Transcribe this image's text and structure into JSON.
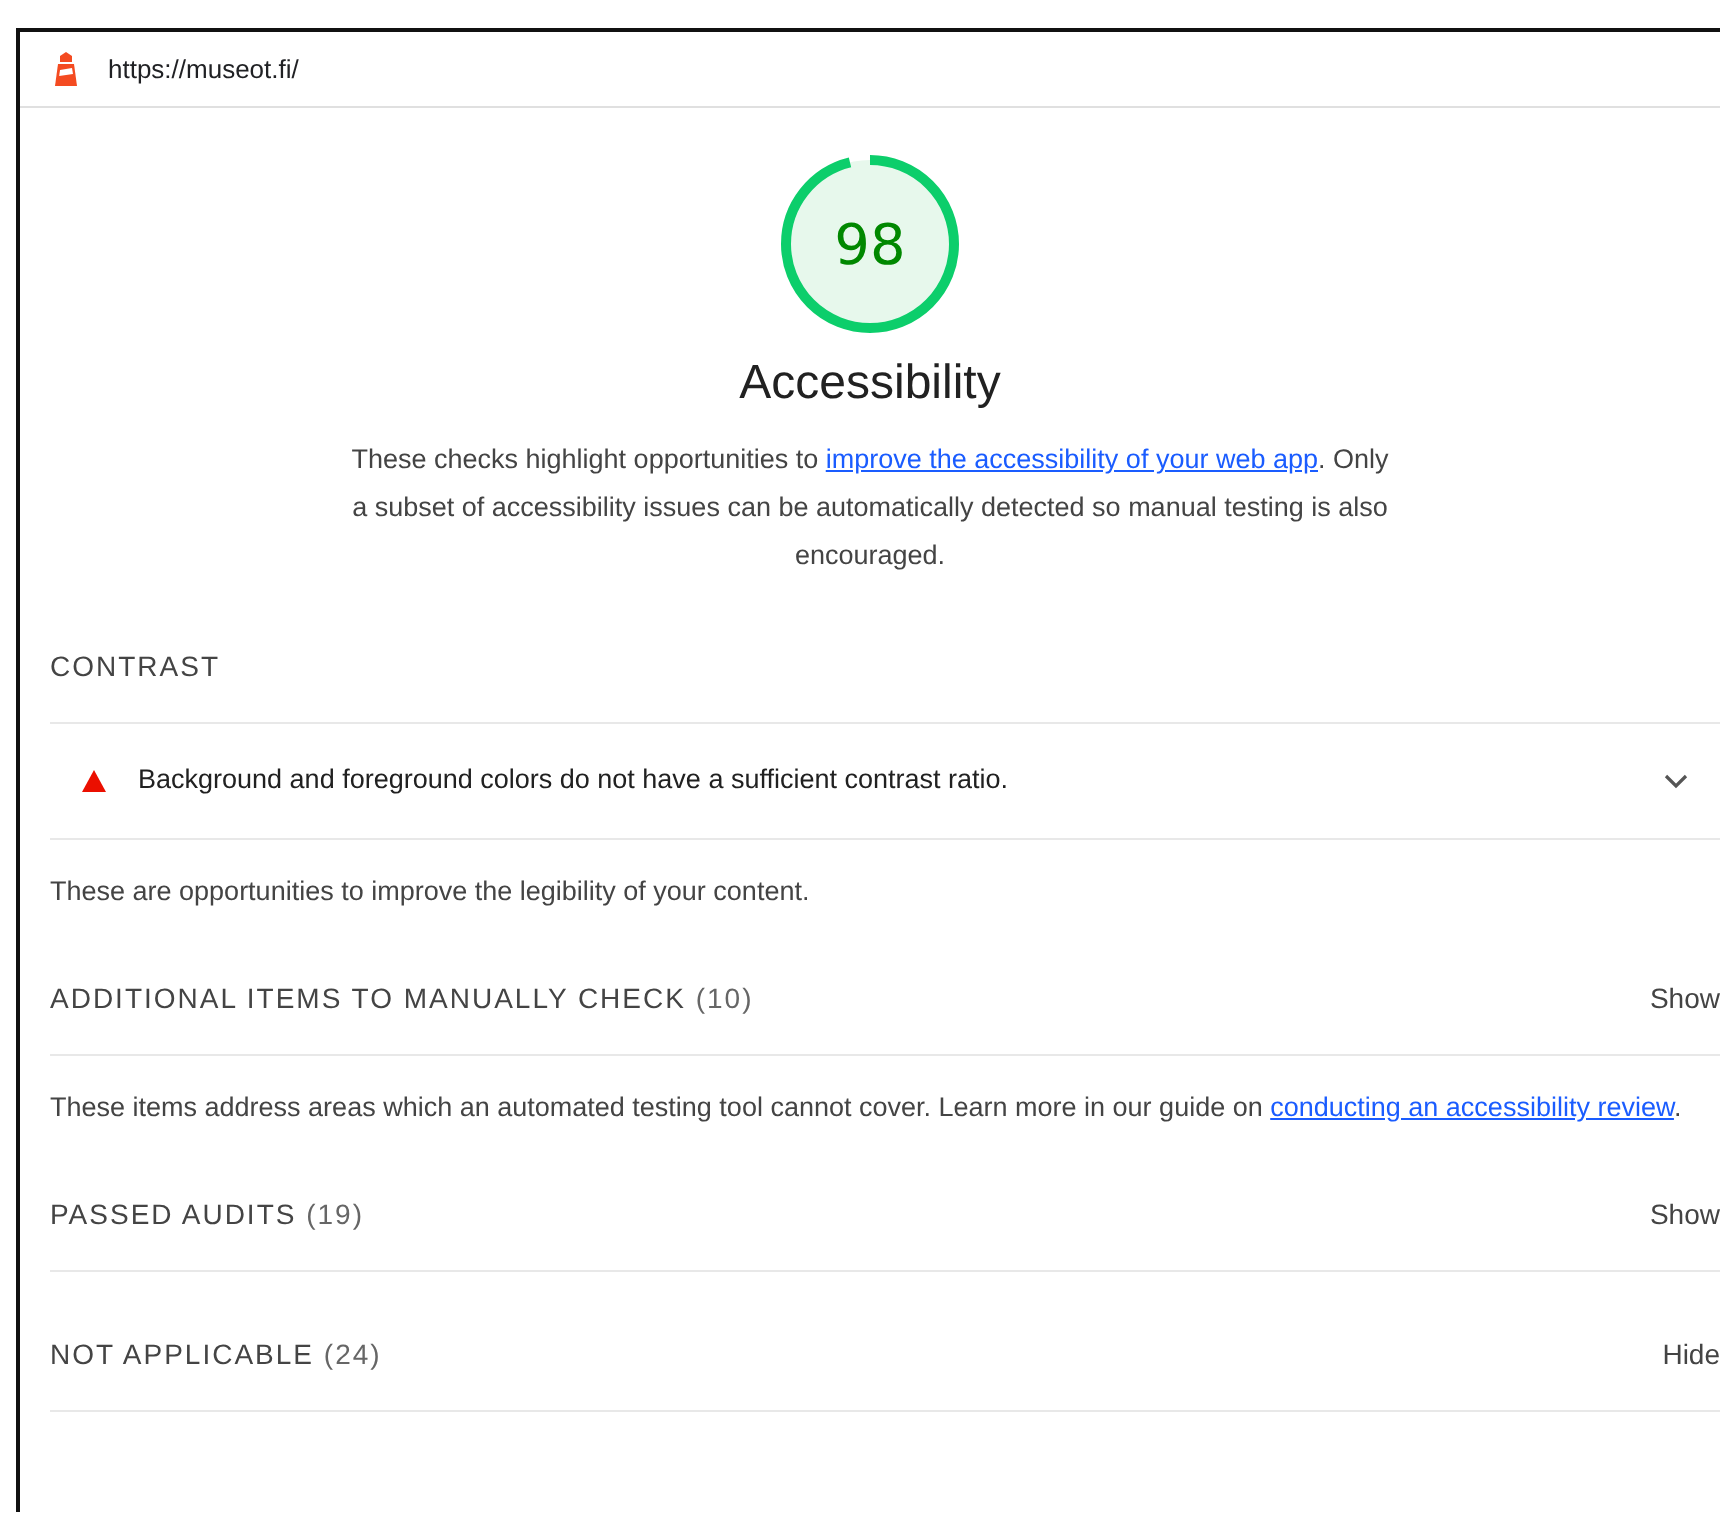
{
  "header": {
    "url": "https://museot.fi/"
  },
  "score": {
    "value": "98",
    "title": "Accessibility",
    "description": {
      "before": "These checks highlight opportunities to ",
      "link": "improve the accessibility of your web app",
      "after": ". Only a subset of accessibility issues can be automatically detected so manual testing is also encouraged."
    }
  },
  "groups": [
    {
      "title": "CONTRAST",
      "audits": [
        {
          "color": "#eb0f00",
          "title": "Background and foreground colors do not have a sufficient contrast ratio.",
          "expanded": false
        }
      ],
      "description": {
        "before": "These are opportunities to improve the legibility of your content."
      }
    },
    {
      "title": "ADDITIONAL ITEMS TO MANUALLY CHECK",
      "count": "(10)",
      "toggle": "Show",
      "description": {
        "before": "These items address areas which an automated testing tool cannot cover. Learn more in our guide on ",
        "link": "conducting an accessibility review",
        "after": "."
      }
    },
    {
      "title": "PASSED AUDITS",
      "count": "(19)",
      "toggle": "Show"
    },
    {
      "title": "NOT APPLICABLE",
      "count": "(24)",
      "toggle": "Hide"
    }
  ]
}
